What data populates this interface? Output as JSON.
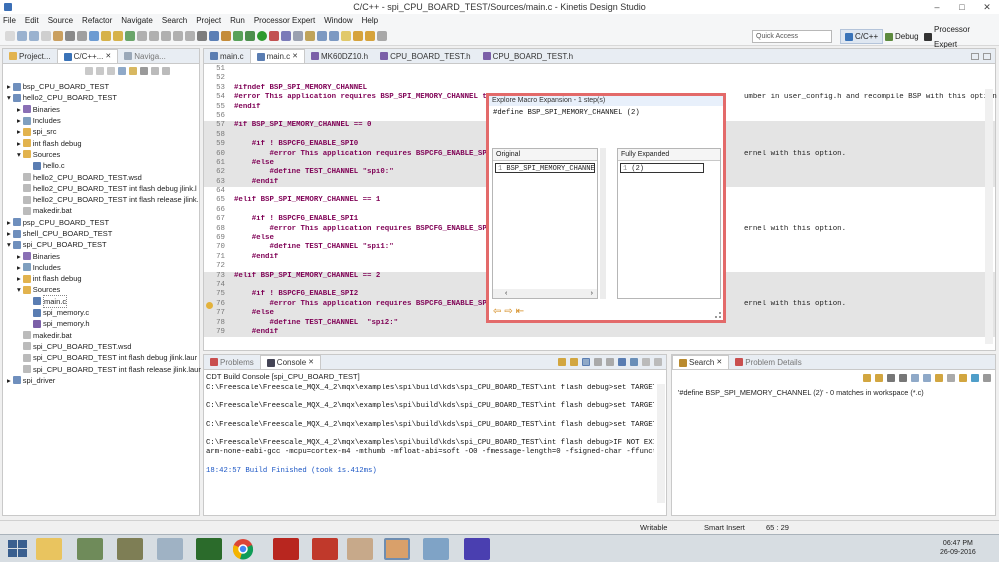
{
  "window": {
    "title": "C/C++ - spi_CPU_BOARD_TEST/Sources/main.c - Kinetis Design Studio"
  },
  "menu": [
    "File",
    "Edit",
    "Source",
    "Refactor",
    "Navigate",
    "Search",
    "Project",
    "Run",
    "Processor Expert",
    "Window",
    "Help"
  ],
  "toolbar": {
    "quick_access_placeholder": "Quick Access",
    "perspectives": [
      "C/C++",
      "Debug",
      "Processor Expert"
    ]
  },
  "project_explorer": {
    "tabs": [
      "Project...",
      "C/C++...",
      "Naviga..."
    ],
    "tree": [
      {
        "label": "bsp_CPU_BOARD_TEST",
        "depth": 0
      },
      {
        "label": "hello2_CPU_BOARD_TEST",
        "depth": 0
      },
      {
        "label": "Binaries",
        "depth": 1
      },
      {
        "label": "Includes",
        "depth": 1
      },
      {
        "label": "spi_src",
        "depth": 1
      },
      {
        "label": "int flash debug",
        "depth": 1
      },
      {
        "label": "Sources",
        "depth": 1
      },
      {
        "label": "hello.c",
        "depth": 2
      },
      {
        "label": "hello2_CPU_BOARD_TEST.wsd",
        "depth": 1
      },
      {
        "label": "hello2_CPU_BOARD_TEST int flash debug jlink.l",
        "depth": 1
      },
      {
        "label": "hello2_CPU_BOARD_TEST int flash release jlink.",
        "depth": 1
      },
      {
        "label": "makedir.bat",
        "depth": 1
      },
      {
        "label": "psp_CPU_BOARD_TEST",
        "depth": 0
      },
      {
        "label": "shell_CPU_BOARD_TEST",
        "depth": 0
      },
      {
        "label": "spi_CPU_BOARD_TEST",
        "depth": 0
      },
      {
        "label": "Binaries",
        "depth": 1
      },
      {
        "label": "Includes",
        "depth": 1
      },
      {
        "label": "int flash debug",
        "depth": 1
      },
      {
        "label": "Sources",
        "depth": 1
      },
      {
        "label": "main.c",
        "depth": 2
      },
      {
        "label": "spi_memory.c",
        "depth": 2
      },
      {
        "label": "spi_memory.h",
        "depth": 2
      },
      {
        "label": "makedir.bat",
        "depth": 1
      },
      {
        "label": "spi_CPU_BOARD_TEST.wsd",
        "depth": 1
      },
      {
        "label": "spi_CPU_BOARD_TEST int flash debug jlink.laur",
        "depth": 1
      },
      {
        "label": "spi_CPU_BOARD_TEST int flash release jlink.laur",
        "depth": 1
      },
      {
        "label": "spi_driver",
        "depth": 0
      }
    ]
  },
  "editor": {
    "tabs": [
      "main.c",
      "main.c",
      "MK60DZ10.h",
      "CPU_BOARD_TEST.h",
      "CPU_BOARD_TEST.h"
    ],
    "lines": [
      {
        "n": "51",
        "t": ""
      },
      {
        "n": "52",
        "t": ""
      },
      {
        "n": "53",
        "t": "#ifndef BSP_SPI_MEMORY_CHANNEL"
      },
      {
        "n": "54",
        "t": "#error This application requires BSP_SPI_MEMORY_CHANNEL to"
      },
      {
        "n": "55",
        "t": "#endif"
      },
      {
        "n": "56",
        "t": ""
      },
      {
        "n": "57",
        "t": "#if BSP_SPI_MEMORY_CHANNEL == 0"
      },
      {
        "n": "58",
        "t": ""
      },
      {
        "n": "59",
        "t": "    #if ! BSPCFG_ENABLE_SPI0"
      },
      {
        "n": "60",
        "t": "        #error This application requires BSPCFG_ENABLE_SPI"
      },
      {
        "n": "61",
        "t": "    #else"
      },
      {
        "n": "62",
        "t": "        #define TEST_CHANNEL \"spi0:\""
      },
      {
        "n": "63",
        "t": "    #endif"
      },
      {
        "n": "64",
        "t": ""
      },
      {
        "n": "65",
        "t": "#elif BSP_SPI_MEMORY_CHANNEL == 1"
      },
      {
        "n": "66",
        "t": ""
      },
      {
        "n": "67",
        "t": "    #if ! BSPCFG_ENABLE_SPI1"
      },
      {
        "n": "68",
        "t": "        #error This application requires BSPCFG_ENABLE_SPI"
      },
      {
        "n": "69",
        "t": "    #else"
      },
      {
        "n": "70",
        "t": "        #define TEST_CHANNEL \"spi1:\""
      },
      {
        "n": "71",
        "t": "    #endif"
      },
      {
        "n": "72",
        "t": ""
      },
      {
        "n": "73",
        "t": "#elif BSP_SPI_MEMORY_CHANNEL == 2"
      },
      {
        "n": "74",
        "t": ""
      },
      {
        "n": "75",
        "t": "    #if ! BSPCFG_ENABLE_SPI2"
      },
      {
        "n": "76",
        "t": "        #error This application requires BSPCFG_ENABLE_SPI"
      },
      {
        "n": "77",
        "t": "    #else"
      },
      {
        "n": "78",
        "t": "        #define TEST_CHANNEL  \"spi2:\""
      },
      {
        "n": "79",
        "t": "    #endif"
      }
    ],
    "right_fragments": {
      "54": "umber in user_config.h and recompile BSP with this option",
      "60": "ernel with this option.",
      "68": "ernel with this option.",
      "76": "ernel with this option."
    }
  },
  "macro_popup": {
    "title": "Explore Macro Expansion - 1 step(s)",
    "definition": "#define BSP_SPI_MEMORY_CHANNEL (2)",
    "original_header": "Original",
    "expanded_header": "Fully Expanded",
    "original_line_no": "1",
    "original_text": "BSP_SPI_MEMORY_CHANNE",
    "expanded_line_no": "1",
    "expanded_text": "(2)"
  },
  "console": {
    "tabs": [
      "Problems",
      "Console"
    ],
    "title": "CDT Build Console [spi_CPU_BOARD_TEST]",
    "lines": [
      "C:\\Freescale\\Freescale_MQX_4_2\\mqx\\examples\\spi\\build\\kds\\spi_CPU_BOARD_TEST\\int flash debug>set TARGETD",
      "",
      "C:\\Freescale\\Freescale_MQX_4_2\\mqx\\examples\\spi\\build\\kds\\spi_CPU_BOARD_TEST\\int flash debug>set TARGETD",
      "",
      "C:\\Freescale\\Freescale_MQX_4_2\\mqx\\examples\\spi\\build\\kds\\spi_CPU_BOARD_TEST\\int flash debug>set TARGETD",
      "",
      "C:\\Freescale\\Freescale_MQX_4_2\\mqx\\examples\\spi\\build\\kds\\spi_CPU_BOARD_TEST\\int flash debug>IF NOT EXIS",
      "arm-none-eabi-gcc -mcpu=cortex-m4 -mthumb -mfloat-abi=soft -O0 -fmessage-length=0 -fsigned-char -ffuncti",
      "",
      "18:42:57 Build Finished (took 1s.412ms)"
    ]
  },
  "search": {
    "tabs": [
      "Search",
      "Problem Details"
    ],
    "result": "'#define BSP_SPI_MEMORY_CHANNEL (2)' - 0 matches in workspace (*.c)"
  },
  "status": {
    "mode": "Writable",
    "insert": "Smart Insert",
    "position": "65 : 29"
  },
  "taskbar": {
    "time": "06:47 PM",
    "date": "26-09-2016"
  }
}
